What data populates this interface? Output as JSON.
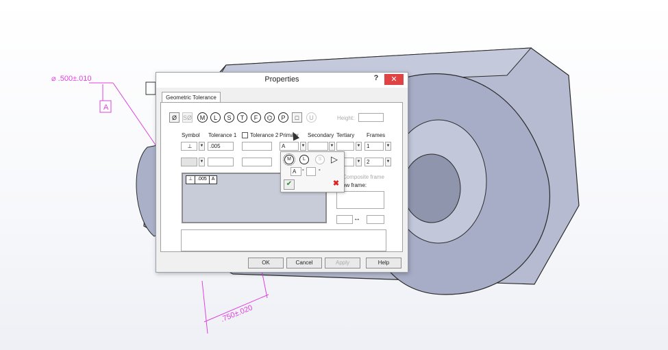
{
  "window": {
    "title": "Properties",
    "help": "?",
    "close": "✕"
  },
  "tab": {
    "label": "Geometric Tolerance"
  },
  "modifier_symbols": [
    "Ø",
    "SØ",
    "M",
    "L",
    "S",
    "T",
    "F",
    "⌬",
    "P",
    "□",
    "U"
  ],
  "height": {
    "label": "Height:",
    "value": ""
  },
  "columns": {
    "symbol": "Symbol",
    "tolerance1": "Tolerance 1",
    "tolerance2": "Tolerance 2",
    "primary": "Primary",
    "secondary": "Secondary",
    "tertiary": "Tertiary",
    "frames": "Frames"
  },
  "row1": {
    "symbol": "⊥",
    "tolerance1": ".005",
    "tolerance2": "",
    "primary": "A",
    "secondary": "",
    "tertiary": "",
    "frames": "1"
  },
  "row2": {
    "symbol": "",
    "tolerance1": "",
    "tolerance2": "",
    "primary": "",
    "secondary": "",
    "tertiary": "",
    "frames": "2"
  },
  "preview": {
    "cells": [
      "⊥",
      ".005",
      "A"
    ]
  },
  "composite": {
    "label": "Composite frame",
    "below_label": "ow frame:"
  },
  "popup": {
    "modifiers": [
      "M",
      "L",
      "S",
      "▷"
    ],
    "datum_value": "A",
    "ok": "✔",
    "cancel": "✖"
  },
  "buttons": {
    "ok": "OK",
    "cancel": "Cancel",
    "apply": "Apply",
    "help": "Help"
  },
  "annotations": {
    "dim1": "⌀ .500±.010",
    "datum": "A",
    "dim2": ".750±.020"
  },
  "colors": {
    "annotation": "#e040e0",
    "part": "#b4b9cf",
    "dialog_bg": "#f0f0f0"
  }
}
